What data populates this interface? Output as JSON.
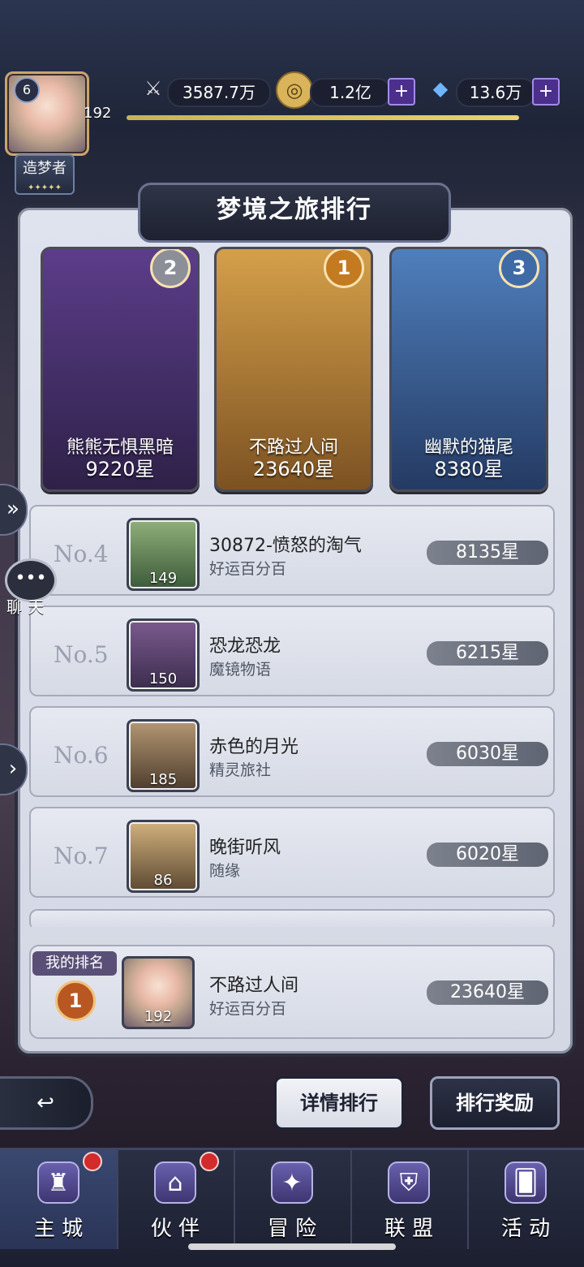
{
  "player": {
    "level": "6",
    "exp": "192",
    "title": "造梦者",
    "title_stars": "✦✦✦✦✦"
  },
  "resources": {
    "power": "3587.7万",
    "gold": "1.2亿",
    "gems": "13.6万",
    "exp_progress": 1.0
  },
  "panel": {
    "title": "梦境之旅排行"
  },
  "top3": [
    {
      "rank": "2",
      "name": "熊熊无惧黑暗",
      "score": "9220星"
    },
    {
      "rank": "1",
      "name": "不路过人间",
      "score": "23640星"
    },
    {
      "rank": "3",
      "name": "幽默的猫尾",
      "score": "8380星"
    }
  ],
  "list": [
    {
      "rank": "No.4",
      "name": "30872-愤怒的淘气",
      "guild": "好运百分百",
      "level": "149",
      "score": "8135星"
    },
    {
      "rank": "No.5",
      "name": "恐龙恐龙",
      "guild": "魔镜物语",
      "level": "150",
      "score": "6215星"
    },
    {
      "rank": "No.6",
      "name": "赤色的月光",
      "guild": "精灵旅社",
      "level": "185",
      "score": "6030星"
    },
    {
      "rank": "No.7",
      "name": "晚街听风",
      "guild": "随缘",
      "level": "86",
      "score": "6020星"
    }
  ],
  "my_rank": {
    "tag": "我的排名",
    "rank": "1",
    "name": "不路过人间",
    "guild": "好运百分百",
    "level": "192",
    "score": "23640星"
  },
  "buttons": {
    "detail": "详情排行",
    "reward": "排行奖励",
    "back": "↩"
  },
  "side": {
    "chat": "聊 天"
  },
  "nav": [
    {
      "label": "主 城",
      "icon": "castle-icon",
      "dot": true,
      "active": true
    },
    {
      "label": "伙 伴",
      "icon": "witch-hat-icon",
      "dot": true,
      "active": false
    },
    {
      "label": "冒 险",
      "icon": "compass-icon",
      "dot": false,
      "active": false
    },
    {
      "label": "联 盟",
      "icon": "shield-icon",
      "dot": false,
      "active": false
    },
    {
      "label": "活 动",
      "icon": "cards-icon",
      "dot": false,
      "active": false
    }
  ],
  "colors": {
    "medal_gold": "#c47a20",
    "medal_silver": "#8c8f98",
    "medal_bronze": "#3e6aa6"
  }
}
